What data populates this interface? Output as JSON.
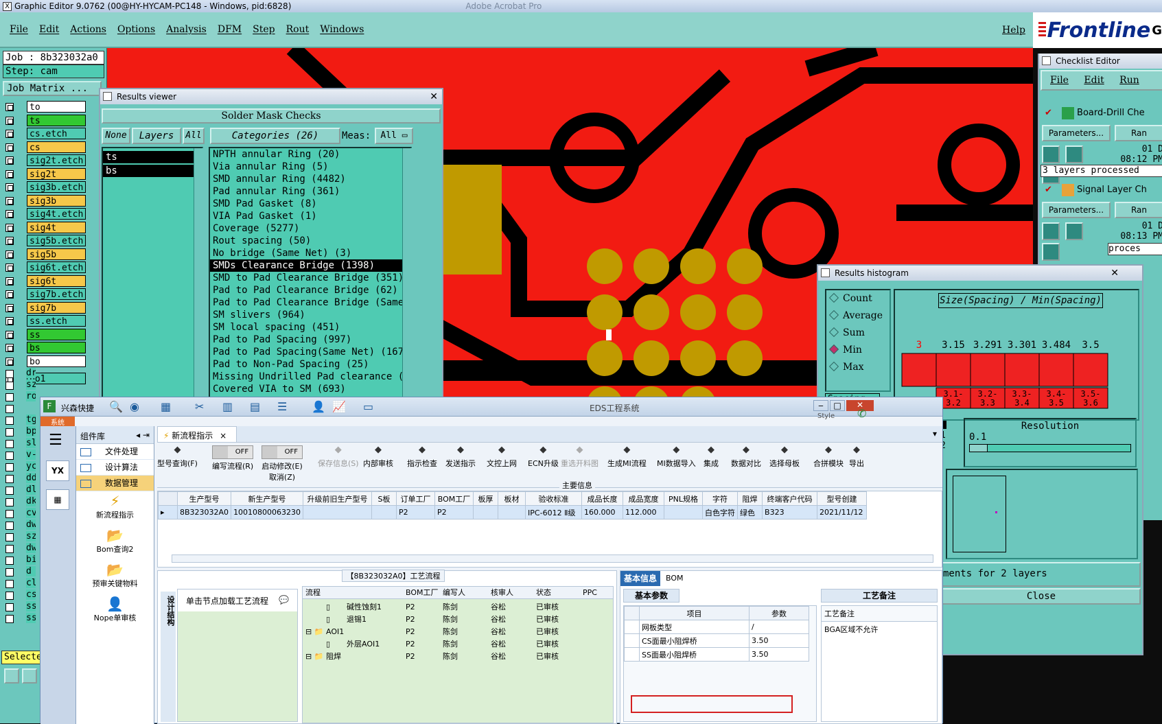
{
  "titlebar": {
    "title": "Graphic Editor 9.0762 (00@HY-HYCAM-PC148 - Windows, pid:6828)",
    "bg_text": "Adobe Acrobat Pro"
  },
  "menu": [
    "File",
    "Edit",
    "Actions",
    "Options",
    "Analysis",
    "DFM",
    "Step",
    "Rout",
    "Windows"
  ],
  "help": "Help",
  "logo": "Frontline",
  "logo_tail": "G",
  "left": {
    "job": "Job : 8b323032a0",
    "step": "Step: cam",
    "job_matrix": "Job Matrix ...",
    "layers": [
      {
        "name": "to",
        "color": "#ffffff"
      },
      {
        "name": "ts",
        "color": "#32c832"
      },
      {
        "name": "cs.etch",
        "color": "#4fcbb2"
      },
      {
        "name": "cs",
        "color": "#f6c84a"
      },
      {
        "name": "sig2t.etch",
        "color": "#4fcbb2"
      },
      {
        "name": "sig2t",
        "color": "#f6c84a"
      },
      {
        "name": "sig3b.etch",
        "color": "#4fcbb2"
      },
      {
        "name": "sig3b",
        "color": "#f6c84a"
      },
      {
        "name": "sig4t.etch",
        "color": "#4fcbb2"
      },
      {
        "name": "sig4t",
        "color": "#f6c84a"
      },
      {
        "name": "sig5b.etch",
        "color": "#4fcbb2"
      },
      {
        "name": "sig5b",
        "color": "#f6c84a"
      },
      {
        "name": "sig6t.etch",
        "color": "#4fcbb2"
      },
      {
        "name": "sig6t",
        "color": "#f6c84a"
      },
      {
        "name": "sig7b.etch",
        "color": "#4fcbb2"
      },
      {
        "name": "sig7b",
        "color": "#f6c84a"
      },
      {
        "name": "ss.etch",
        "color": "#4fcbb2"
      },
      {
        "name": "ss",
        "color": "#32c832"
      },
      {
        "name": "bs",
        "color": "#32c832"
      },
      {
        "name": "bo",
        "color": "#ffffff"
      },
      {
        "name": "bo1",
        "color": "#4fcbb2"
      }
    ],
    "side_labels": [
      "dr",
      "sz",
      "ro",
      "",
      "tg",
      "bp",
      "sl",
      "v-",
      "yc",
      "dd",
      "dl",
      "dk",
      "cv",
      "dw",
      "sz",
      "dw",
      "bi",
      "d",
      "cl",
      "cs",
      "ss",
      "ss"
    ],
    "select": "Selecte"
  },
  "results_viewer": {
    "title": "Results viewer",
    "header": "Solder Mask Checks",
    "none": "None",
    "layers": "Layers",
    "all": "All",
    "categories": "Categories (26)",
    "meas": "Meas:",
    "meas_val": "All",
    "layer_items": [
      "ts",
      "bs"
    ],
    "category_items": [
      "NPTH annular Ring (20)",
      "Via annular Ring (5)",
      "SMD annular Ring (4482)",
      "Pad annular Ring (361)",
      "SMD Pad Gasket (8)",
      "VIA Pad Gasket (1)",
      "Coverage (5277)",
      "Rout spacing (50)",
      "No bridge (Same Net) (3)",
      "SMDs Clearance Bridge (1398)",
      "SMD to Pad Clearance Bridge (351)",
      "Pad to Pad Clearance Bridge (62)",
      "Pad to Pad Clearance Bridge (Same",
      "SM slivers (964)",
      "SM local spacing (451)",
      "Pad to Pad Spacing (997)",
      "Pad to Pad Spacing(Same Net) (167",
      "Pad to Non-Pad Spacing (25)",
      "Missing Undrilled Pad clearance (",
      "Covered VIA to SM (693)"
    ],
    "selected_index": 9
  },
  "checklist": {
    "title": "Checklist Editor",
    "menu": [
      "File",
      "Edit",
      "Run"
    ],
    "item1": "Board-Drill Che",
    "params": "Parameters...",
    "ran": "Ran",
    "date1": "01 D",
    "time1": "08:12 PM",
    "processed": "3 layers processed",
    "item2": "Signal Layer Ch",
    "date2": "01 D",
    "time2": "08:13 PM",
    "processed2": "proces"
  },
  "histogram": {
    "title": "Results histogram",
    "options": [
      "Count",
      "Average",
      "Sum",
      "Min",
      "Max"
    ],
    "selected": "Min",
    "field": "Spacing",
    "chart_title": "Size(Spacing) / Min(Spacing)",
    "resolution_label": "Resolution",
    "resolution_value": "0.1",
    "rows": [
      "1",
      "2"
    ],
    "status": "ments for 2 layers",
    "close": "Close"
  },
  "chart_data": {
    "type": "bar",
    "title": "Size(Spacing) / Min(Spacing)",
    "categories": [
      "3.1-3.2",
      "3.2-3.3",
      "3.3-3.4",
      "3.4-3.5",
      "3.5-3.6"
    ],
    "values": [
      3.15,
      3.291,
      3.301,
      3.484,
      3.5
    ],
    "first_label": "3",
    "bar_color": "#ee2222",
    "label_color": "#ff0000"
  },
  "eds": {
    "title": "EDS工程系统",
    "app_label": "兴森快捷",
    "sys": "系统",
    "style": "Style",
    "lib": "组件库",
    "lib_items": [
      "文件处理",
      "设计算法",
      "数据管理"
    ],
    "tree_items": [
      "新流程指示",
      "Bom查询2",
      "预审关键物料",
      "Nope单审核"
    ],
    "tab": "新流程指示",
    "toolbar": [
      {
        "label": "型号查询(F)"
      },
      {
        "label": "编写流程(R)"
      },
      {
        "label": "启动修改(E)"
      },
      {
        "label": "保存信息(S)"
      },
      {
        "label": "内部审核"
      },
      {
        "label": "指示检查"
      },
      {
        "label": "发送指示"
      },
      {
        "label": "文控上网"
      },
      {
        "label": "ECN升级"
      },
      {
        "label": "重选开料图"
      },
      {
        "label": "生成MI流程"
      },
      {
        "label": "MI数据导入"
      },
      {
        "label": "集成"
      },
      {
        "label": "数据对比"
      },
      {
        "label": "选择母板"
      },
      {
        "label": "合拼模块"
      },
      {
        "label": "导出"
      }
    ],
    "off": "OFF",
    "cancel": "取消(Z)",
    "section": "主要信息",
    "columns": [
      "生产型号",
      "新生产型号",
      "升级前旧生产型号",
      "S板",
      "订单工厂",
      "BOM工厂",
      "板厚",
      "板材",
      "验收标准",
      "成品长度",
      "成品宽度",
      "PNL规格",
      "字符",
      "阻焊",
      "终端客户代码",
      "型号创建"
    ],
    "row": [
      "8B323032A0",
      "10010800063230",
      "",
      "",
      "P2",
      "P2",
      "",
      "",
      "IPC-6012 Ⅱ级",
      "160.000",
      "112.000",
      "",
      "白色字符",
      "绿色",
      "B323",
      "2021/11/12"
    ],
    "flow_title": "【8B323032A0】工艺流程",
    "side_tab": "设计结构",
    "node_hint": "单击节点加载工艺流程",
    "flow_columns": [
      "流程",
      "BOM工厂",
      "编写人",
      "核审人",
      "状态",
      "PPC"
    ],
    "flow_rows": [
      [
        "碱性蚀刻1",
        "P2",
        "陈剑",
        "谷松",
        "已审核"
      ],
      [
        "退锡1",
        "P2",
        "陈剑",
        "谷松",
        "已审核"
      ],
      [
        "AOI1",
        "P2",
        "陈剑",
        "谷松",
        "已审核"
      ],
      [
        "外层AOI1",
        "P2",
        "陈剑",
        "谷松",
        "已审核"
      ],
      [
        "阻焊",
        "P2",
        "陈剑",
        "谷松",
        "已审核"
      ]
    ],
    "info_tabs": [
      "基本信息",
      "BOM"
    ],
    "basic": "基本参数",
    "craft": "工艺备注",
    "param_cols": [
      "项目",
      "参数"
    ],
    "params": [
      [
        "网板类型",
        "/"
      ],
      [
        "CS面最小阻焊桥",
        "3.50"
      ],
      [
        "SS面最小阻焊桥",
        "3.50"
      ]
    ],
    "craft_col": "工艺备注",
    "craft_text": "BGA区域不允许"
  }
}
